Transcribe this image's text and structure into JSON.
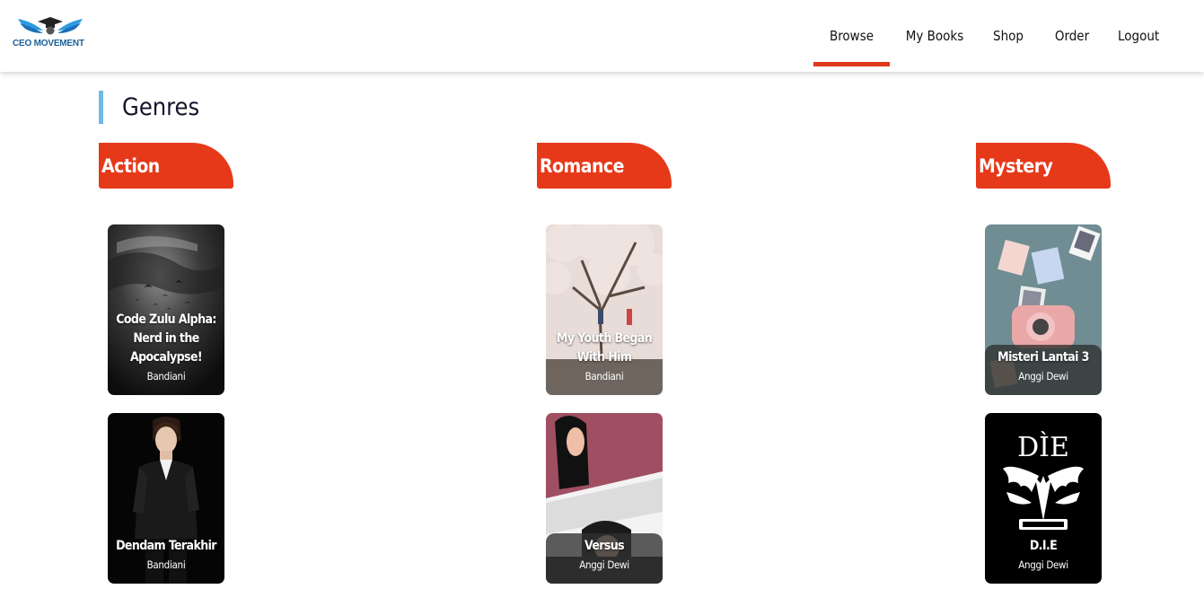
{
  "header": {
    "logo_text": "CEO MOVEMENT",
    "nav": {
      "browse": "Browse",
      "my_books": "My Books",
      "shop": "Shop",
      "order": "Order",
      "logout": "Logout"
    },
    "active_nav": "Browse",
    "accent_color": "#e0381c"
  },
  "main": {
    "section_title": "Genres",
    "genres": [
      {
        "name": "Action",
        "books": [
          {
            "title": "Code Zulu Alpha: Nerd in the Apocalypse!",
            "author": "Bandiani"
          },
          {
            "title": "Dendam Terakhir",
            "author": "Bandiani"
          }
        ]
      },
      {
        "name": "Romance",
        "books": [
          {
            "title": "My Youth Began With Him",
            "author": "Bandiani"
          },
          {
            "title": "Versus",
            "author": "Anggi Dewi"
          }
        ]
      },
      {
        "name": "Mystery",
        "books": [
          {
            "title": "Misteri Lantai 3",
            "author": "Anggi Dewi"
          },
          {
            "title": "D.I.E",
            "author": "Anggi Dewi",
            "cover_text": "DÌE"
          }
        ]
      }
    ]
  },
  "colors": {
    "genre_tab": "#e6391a",
    "title_bar": "#6fb8e8",
    "brand": "#1d5f99"
  }
}
